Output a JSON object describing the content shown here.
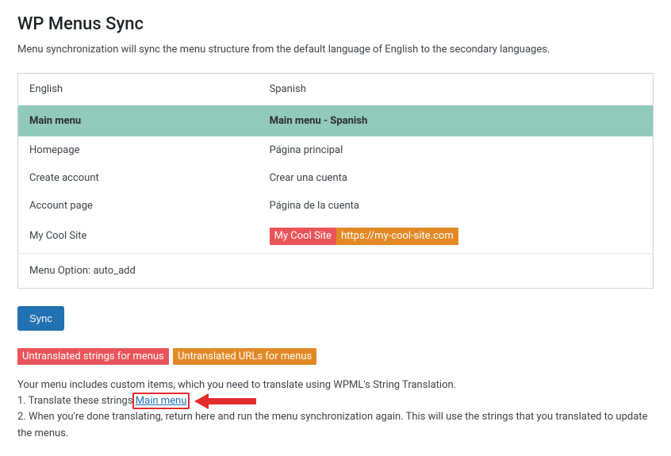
{
  "page": {
    "title": "WP Menus Sync",
    "intro": "Menu synchronization will sync the menu structure from the default language of English to the secondary languages."
  },
  "table": {
    "headers": {
      "source": "English",
      "target": "Spanish"
    },
    "menu_name": {
      "source": "Main menu",
      "target": "Main menu - Spanish"
    },
    "items": [
      {
        "source": "Homepage",
        "target_text": "Página principal",
        "target_pills": []
      },
      {
        "source": "Create account",
        "target_text": "Crear una cuenta",
        "target_pills": []
      },
      {
        "source": "Account page",
        "target_text": "Página de la cuenta",
        "target_pills": []
      },
      {
        "source": "My Cool Site",
        "target_text": "",
        "target_pills": [
          {
            "text": "My Cool Site",
            "color": "red"
          },
          {
            "text": "https://my-cool-site.com",
            "color": "orange"
          }
        ]
      }
    ],
    "option_row": "Menu Option: auto_add"
  },
  "buttons": {
    "sync": "Sync"
  },
  "legend": {
    "untranslated_strings": "Untranslated strings for menus",
    "untranslated_urls": "Untranslated URLs for menus"
  },
  "instructions": {
    "intro": "Your menu includes custom items, which you need to translate using WPML's String Translation.",
    "step1_prefix": "1. Translate these strings ",
    "step1_link": "Main menu",
    "step2": "2. When you're done translating, return here and run the menu synchronization again. This will use the strings that you translated to update the menus."
  },
  "colors": {
    "pill_red": "#ea5459",
    "pill_orange": "#e28926",
    "button_primary": "#2271b1",
    "menu_row_bg": "#91cabd",
    "annotation_red": "#e22b2b"
  }
}
